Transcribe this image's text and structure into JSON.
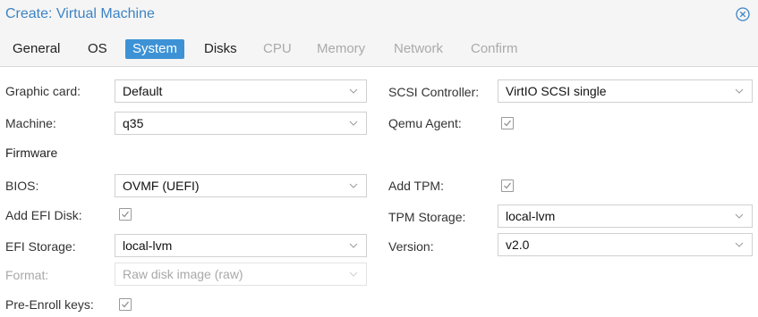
{
  "window": {
    "title": "Create: Virtual Machine",
    "close_icon": "close-circle-icon"
  },
  "tabs": [
    {
      "label": "General",
      "state": "enabled"
    },
    {
      "label": "OS",
      "state": "enabled"
    },
    {
      "label": "System",
      "state": "active"
    },
    {
      "label": "Disks",
      "state": "enabled"
    },
    {
      "label": "CPU",
      "state": "disabled"
    },
    {
      "label": "Memory",
      "state": "disabled"
    },
    {
      "label": "Network",
      "state": "disabled"
    },
    {
      "label": "Confirm",
      "state": "disabled"
    }
  ],
  "left": {
    "graphic_card": {
      "label": "Graphic card:",
      "value": "Default"
    },
    "machine": {
      "label": "Machine:",
      "value": "q35"
    },
    "firmware_heading": "Firmware",
    "bios": {
      "label": "BIOS:",
      "value": "OVMF (UEFI)"
    },
    "add_efi_disk": {
      "label": "Add EFI Disk:",
      "checked": true
    },
    "efi_storage": {
      "label": "EFI Storage:",
      "value": "local-lvm"
    },
    "format": {
      "label": "Format:",
      "value": "Raw disk image (raw)",
      "disabled": true
    },
    "pre_enroll_keys": {
      "label": "Pre-Enroll keys:",
      "checked": true
    }
  },
  "right": {
    "scsi_controller": {
      "label": "SCSI Controller:",
      "value": "VirtIO SCSI single"
    },
    "qemu_agent": {
      "label": "Qemu Agent:",
      "checked": true
    },
    "add_tpm": {
      "label": "Add TPM:",
      "checked": true
    },
    "tpm_storage": {
      "label": "TPM Storage:",
      "value": "local-lvm"
    },
    "version": {
      "label": "Version:",
      "value": "v2.0"
    }
  },
  "colors": {
    "accent": "#3d92d6",
    "title": "#3d84c4",
    "disabled_text": "#aaaaaa"
  }
}
